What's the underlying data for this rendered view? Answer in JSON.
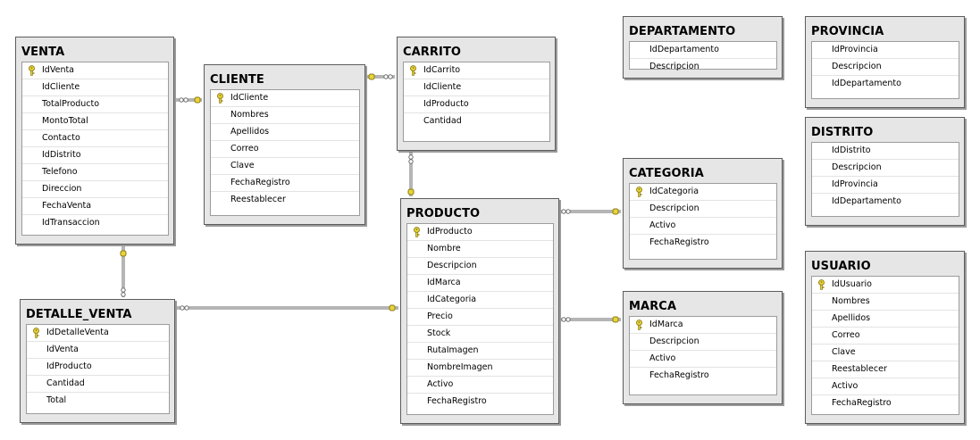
{
  "tables": {
    "venta": {
      "title": "VENTA",
      "columns": [
        "IdVenta",
        "IdCliente",
        "TotalProducto",
        "MontoTotal",
        "Contacto",
        "IdDistrito",
        "Telefono",
        "Direccion",
        "FechaVenta",
        "IdTransaccion"
      ]
    },
    "cliente": {
      "title": "CLIENTE",
      "columns": [
        "IdCliente",
        "Nombres",
        "Apellidos",
        "Correo",
        "Clave",
        "FechaRegistro",
        "Reestablecer"
      ]
    },
    "carrito": {
      "title": "CARRITO",
      "columns": [
        "IdCarrito",
        "IdCliente",
        "IdProducto",
        "Cantidad"
      ]
    },
    "detalle_venta": {
      "title": "DETALLE_VENTA",
      "columns": [
        "IdDetalleVenta",
        "IdVenta",
        "IdProducto",
        "Cantidad",
        "Total"
      ]
    },
    "producto": {
      "title": "PRODUCTO",
      "columns": [
        "IdProducto",
        "Nombre",
        "Descripcion",
        "IdMarca",
        "IdCategoria",
        "Precio",
        "Stock",
        "RutaImagen",
        "NombreImagen",
        "Activo",
        "FechaRegistro"
      ]
    },
    "departamento": {
      "title": "DEPARTAMENTO",
      "columns": [
        "IdDepartamento",
        "Descripcion"
      ]
    },
    "categoria": {
      "title": "CATEGORIA",
      "columns": [
        "IdCategoria",
        "Descripcion",
        "Activo",
        "FechaRegistro"
      ]
    },
    "marca": {
      "title": "MARCA",
      "columns": [
        "IdMarca",
        "Descripcion",
        "Activo",
        "FechaRegistro"
      ]
    },
    "provincia": {
      "title": "PROVINCIA",
      "columns": [
        "IdProvincia",
        "Descripcion",
        "IdDepartamento"
      ]
    },
    "distrito": {
      "title": "DISTRITO",
      "columns": [
        "IdDistrito",
        "Descripcion",
        "IdProvincia",
        "IdDepartamento"
      ]
    },
    "usuario": {
      "title": "USUARIO",
      "columns": [
        "IdUsuario",
        "Nombres",
        "Apellidos",
        "Correo",
        "Clave",
        "Reestablecer",
        "Activo",
        "FechaRegistro"
      ]
    }
  },
  "colors": {
    "key": "#e8d43a",
    "key_outline": "#8a7a10",
    "line": "#6b6b6b"
  }
}
